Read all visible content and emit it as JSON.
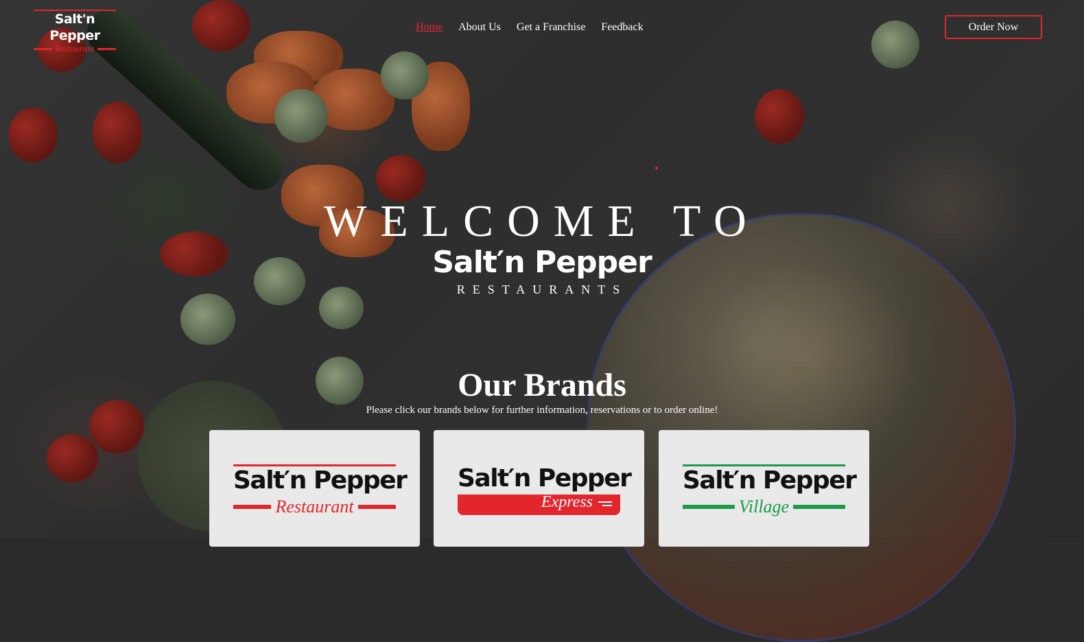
{
  "header": {
    "logo_main": "Salt'n Pepper",
    "logo_sub": "Restaurant"
  },
  "nav": {
    "items": [
      "Home",
      "About Us",
      "Get a Franchise",
      "Feedback"
    ],
    "active": "Home"
  },
  "order_button": "Order Now",
  "hero": {
    "welcome": "WELCOME TO",
    "brand": "Salt′n Pepper",
    "tagline": "RESTAURANTS"
  },
  "brands": {
    "title": "Our Brands",
    "subtitle": "Please click our brands below for further information, reservations or to order online!",
    "cards": [
      {
        "main": "Salt′n Pepper",
        "sub": "Restaurant",
        "accent": "#e3262c"
      },
      {
        "main": "Salt′n Pepper",
        "sub": "Express",
        "accent": "#e3262c"
      },
      {
        "main": "Salt′n Pepper",
        "sub": "Village",
        "accent": "#1a9a4a"
      }
    ]
  },
  "colors": {
    "accent_red": "#e3262c",
    "accent_green": "#1a9a4a",
    "overlay": "#2b2b2b",
    "card_bg": "#e9e9e9"
  }
}
